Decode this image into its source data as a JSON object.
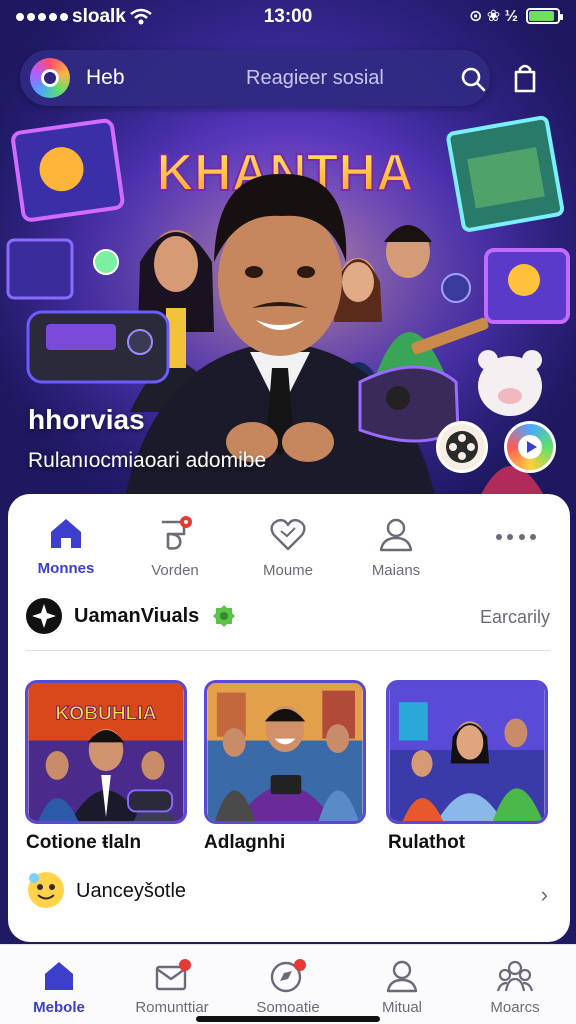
{
  "status_bar": {
    "carrier": "sloalk",
    "time": "13:00",
    "icons_text": "⊙ ❀ ½",
    "battery_level": 0.9
  },
  "search": {
    "brand": "Heb",
    "placeholder": "Reagieer sosial"
  },
  "hero": {
    "banner_title": "KHANTHA",
    "title": "hhorvias",
    "subtitle": "Rulanıocmiaoari adomibe"
  },
  "tabs": [
    {
      "label": "Monnes",
      "icon": "home-icon",
      "active": true
    },
    {
      "label": "Vorden",
      "icon": "note-icon",
      "badge": true
    },
    {
      "label": "Moume",
      "icon": "heart-icon"
    },
    {
      "label": "Maians",
      "icon": "person-icon"
    },
    {
      "label": "",
      "icon": "more-icon"
    }
  ],
  "section": {
    "name": "UamanViuals",
    "see_all": "Earcarily"
  },
  "thumbnails": [
    {
      "banner": "KOBUHLIA",
      "title": "Cotione ŧlaln"
    },
    {
      "banner": "",
      "title": "Adlagnhi"
    },
    {
      "banner": "",
      "title": "Rulathot"
    }
  ],
  "list_item": {
    "label": "Uanceyšotle",
    "chevron": "›"
  },
  "bottom_nav": [
    {
      "label": "Mebole",
      "icon": "home-icon",
      "active": true
    },
    {
      "label": "Romunttiar",
      "icon": "mail-icon",
      "badge": true
    },
    {
      "label": "Somoatie",
      "icon": "compass-icon",
      "badge": true
    },
    {
      "label": "Mitual",
      "icon": "person-icon"
    },
    {
      "label": "Moarcs",
      "icon": "group-icon"
    }
  ],
  "colors": {
    "accent": "#3b3fc9",
    "header_bg": "#1d1860",
    "badge": "#e53935"
  }
}
